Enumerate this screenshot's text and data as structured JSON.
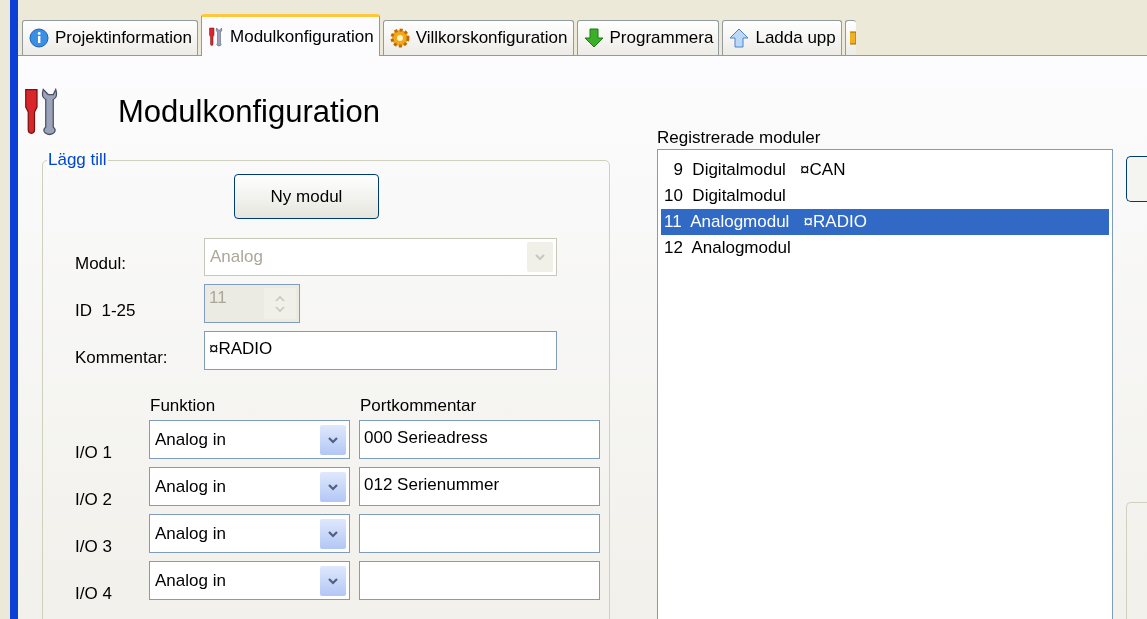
{
  "tabs": [
    {
      "kind": "info",
      "label": "Projektinformation",
      "selected": false
    },
    {
      "kind": "tools",
      "label": "Modulkonfiguration",
      "selected": true
    },
    {
      "kind": "gear",
      "label": "Villkorskonfiguration",
      "selected": false
    },
    {
      "kind": "down",
      "label": "Programmera",
      "selected": false
    },
    {
      "kind": "up",
      "label": "Ladda upp",
      "selected": false
    },
    {
      "kind": "partial",
      "selected": false
    }
  ],
  "page": {
    "title": "Modulkonfiguration"
  },
  "add_group": {
    "title": "Lägg till",
    "new_button": "Ny modul",
    "module": {
      "label": "Modul:",
      "value": "Analog",
      "disabled": true
    },
    "id": {
      "label": "ID  1-25",
      "value": "11",
      "disabled": true
    },
    "comment": {
      "label": "Kommentar:",
      "value": "¤RADIO"
    },
    "columns": [
      "Funktion",
      "Portkommentar"
    ],
    "ports": [
      {
        "label": "I/O 1",
        "function": "Analog in",
        "comment": "000 Serieadress"
      },
      {
        "label": "I/O 2",
        "function": "Analog in",
        "comment": "012 Serienummer"
      },
      {
        "label": "I/O 3",
        "function": "Analog in"
      },
      {
        "label": "I/O 4",
        "function": "Analog in"
      }
    ]
  },
  "registered": {
    "label": "Registrerade moduler",
    "items": [
      {
        "id": "9",
        "name": "Digitalmodul",
        "comment": "¤CAN",
        "selected": false
      },
      {
        "id": "10",
        "name": "Digitalmodul",
        "selected": false
      },
      {
        "id": "11",
        "name": "Analogmodul",
        "comment": "¤RADIO",
        "selected": true
      },
      {
        "id": "12",
        "name": "Analogmodul",
        "selected": false
      }
    ]
  }
}
